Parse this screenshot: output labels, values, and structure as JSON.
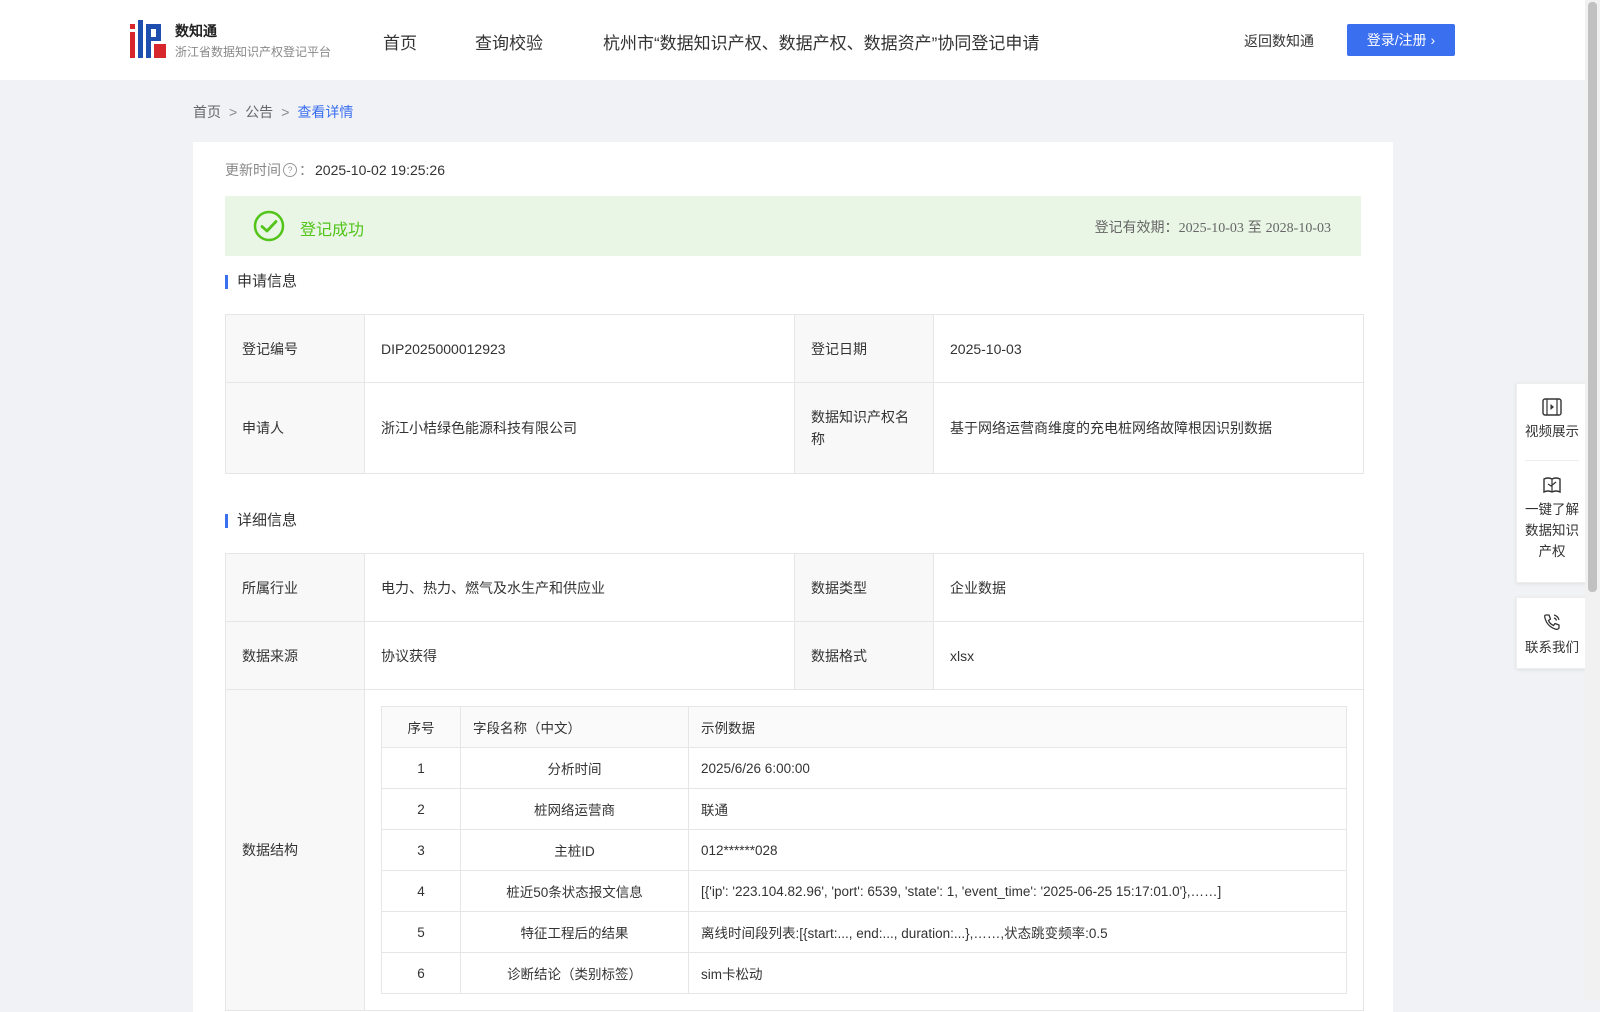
{
  "header": {
    "brand_name": "数知通",
    "brand_sub": "浙江省数据知识产权登记平台",
    "nav": [
      "首页",
      "查询校验",
      "杭州市“数据知识产权、数据产权、数据资产”协同登记申请"
    ],
    "back_link": "返回数知通",
    "login": "登录/注册"
  },
  "breadcrumb": {
    "home": "首页",
    "notice": "公告",
    "current": "查看详情",
    "sep": ">"
  },
  "update": {
    "label": "更新时间",
    "colon": "：",
    "value": "2025-10-02 19:25:26"
  },
  "banner": {
    "status": "登记成功",
    "validity_label": "登记有效期：",
    "start": "2025-10-03",
    "to": "至",
    "end": "2028-10-03",
    "color": "#52c41a",
    "bg": "#e9f6e5"
  },
  "apply_info": {
    "title": "申请信息",
    "reg_no_label": "登记编号",
    "reg_no": "DIP2025000012923",
    "reg_date_label": "登记日期",
    "reg_date": "2025-10-03",
    "applicant_label": "申请人",
    "applicant": "浙江小桔绿色能源科技有限公司",
    "ip_name_label": "数据知识产权名称",
    "ip_name": "基于网络运营商维度的充电桩网络故障根因识别数据"
  },
  "detail_info": {
    "title": "详细信息",
    "industry_label": "所属行业",
    "industry": "电力、热力、燃气及水生产和供应业",
    "type_label": "数据类型",
    "type": "企业数据",
    "source_label": "数据来源",
    "source": "协议获得",
    "format_label": "数据格式",
    "format": "xlsx",
    "structure_label": "数据结构",
    "columns": [
      "序号",
      "字段名称（中文）",
      "示例数据"
    ],
    "rows": [
      [
        "1",
        "分析时间",
        "2025/6/26 6:00:00"
      ],
      [
        "2",
        "桩网络运营商",
        "联通"
      ],
      [
        "3",
        "主桩ID",
        "012******028"
      ],
      [
        "4",
        "桩近50条状态报文信息",
        "[{'ip': '223.104.82.96', 'port': 6539, 'state': 1, 'event_time': '2025-06-25 15:17:01.0'},……]"
      ],
      [
        "5",
        "特征工程后的结果",
        "离线时间段列表:[{start:..., end:..., duration:...},……,状态跳变频率:0.5"
      ],
      [
        "6",
        "诊断结论（类别标签）",
        "sim卡松动"
      ]
    ]
  },
  "side": {
    "video": "视频展示",
    "learn": [
      "一键了解",
      "数据知识",
      "产权"
    ],
    "contact": "联系我们"
  },
  "colors": {
    "accent": "#3a6ff0",
    "success": "#52c41a"
  }
}
